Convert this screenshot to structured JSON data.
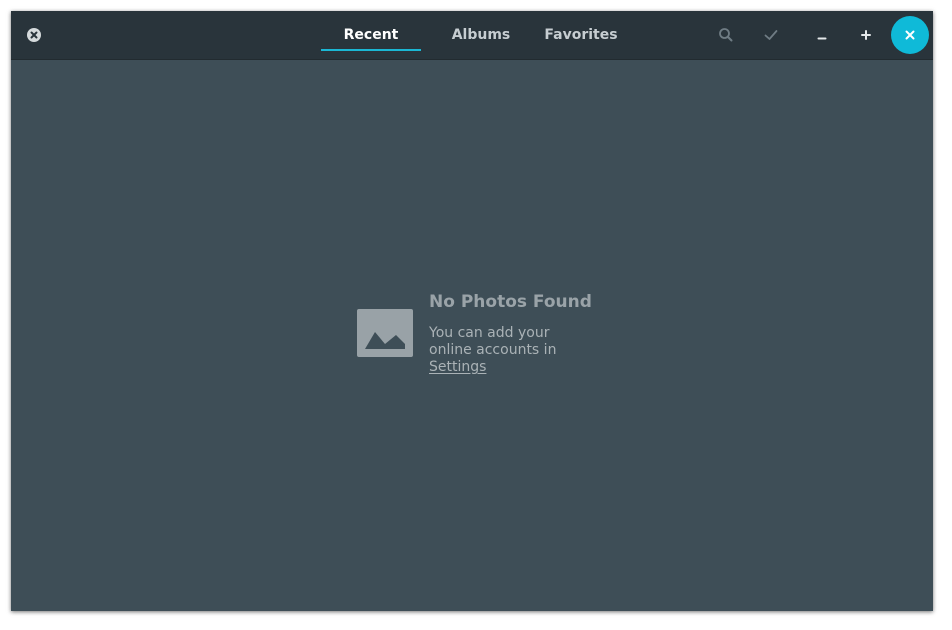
{
  "window": {
    "tabs": [
      {
        "label": "Recent",
        "active": true
      },
      {
        "label": "Albums",
        "active": false
      },
      {
        "label": "Favorites",
        "active": false
      }
    ],
    "icons": {
      "left": "close-circle-icon",
      "search": "search-icon",
      "select": "checkmark-icon",
      "minimize": "minimize-icon",
      "maximize": "plus-icon",
      "close": "close-icon"
    },
    "colors": {
      "accent": "#1bb7d4",
      "close_button": "#0fbad8",
      "headerbar": "#29343b",
      "background": "#3e4e57"
    }
  },
  "empty_state": {
    "icon": "image-placeholder-icon",
    "title": "No Photos Found",
    "line1": "You can add your",
    "line2": "online accounts in",
    "link": "Settings"
  }
}
